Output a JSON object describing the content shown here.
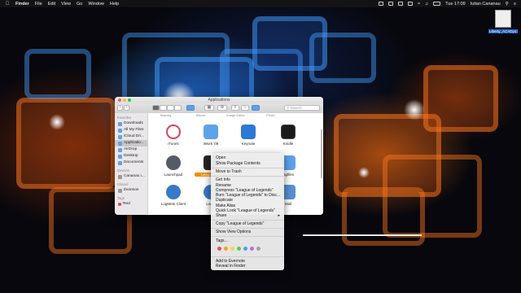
{
  "menubar": {
    "app": "Finder",
    "items": [
      "File",
      "Edit",
      "View",
      "Go",
      "Window",
      "Help"
    ],
    "clock": "Tue 17:09",
    "user": "Iulian Cananau"
  },
  "desktop": {
    "file_label": "Liberty_ACADyo.la"
  },
  "finder": {
    "title": "Applications",
    "search_placeholder": "Search",
    "partial_labels": [
      "iMazing",
      "iMovie",
      "Image Editor",
      "Photo"
    ],
    "sidebar": {
      "favorites_heading": "Favorites",
      "favorites": [
        "Downloads",
        "All My Files",
        "iCloud Dri...",
        "Applicatio...",
        "AirDrop",
        "Desktop",
        "Documents"
      ],
      "devices_heading": "Devices",
      "devices": [
        "Cananau i..."
      ],
      "shared_heading": "Shared",
      "shared": [
        "thomson"
      ],
      "tags_heading": "Tags",
      "tags": [
        "Red"
      ]
    },
    "apps": [
      {
        "label": "iTunes",
        "color": "#e04060"
      },
      {
        "label": "iWork '09",
        "color": "#3f8fe0"
      },
      {
        "label": "Keynote",
        "color": "#2c7ad6"
      },
      {
        "label": "Kindle",
        "color": "#1a1a1a"
      },
      {
        "label": "Launchpad",
        "color": "#555b66"
      },
      {
        "label": "League of...",
        "color": "#2a2420"
      },
      {
        "label": "",
        "color": "#cccccc"
      },
      {
        "label": "lagfiles",
        "color": "#3f8fe0"
      },
      {
        "label": "LogMeIn Client",
        "color": "#3a78c8"
      },
      {
        "label": "LogM",
        "color": "#3a78c8"
      },
      {
        "label": "",
        "color": "#dddddd"
      },
      {
        "label": "Mail",
        "color": "#5a8fd0"
      }
    ]
  },
  "context_menu": {
    "items": [
      "Open",
      "Show Package Contents",
      "Move to Trash",
      "Get Info",
      "Rename",
      "Compress \"League of Legends\"",
      "Burn \"League of Legends\" to Disc...",
      "Duplicate",
      "Make Alias",
      "Quick Look \"League of Legends\"",
      "Share",
      "Copy \"League of Legends\"",
      "Show View Options",
      "Tags...",
      "Add to Evernote",
      "Reveal in Finder"
    ],
    "tag_colors": [
      "#f04a4a",
      "#f5a023",
      "#f5d43a",
      "#5cc95c",
      "#4a9ef0",
      "#b070e0",
      "#a0a0a0"
    ]
  }
}
